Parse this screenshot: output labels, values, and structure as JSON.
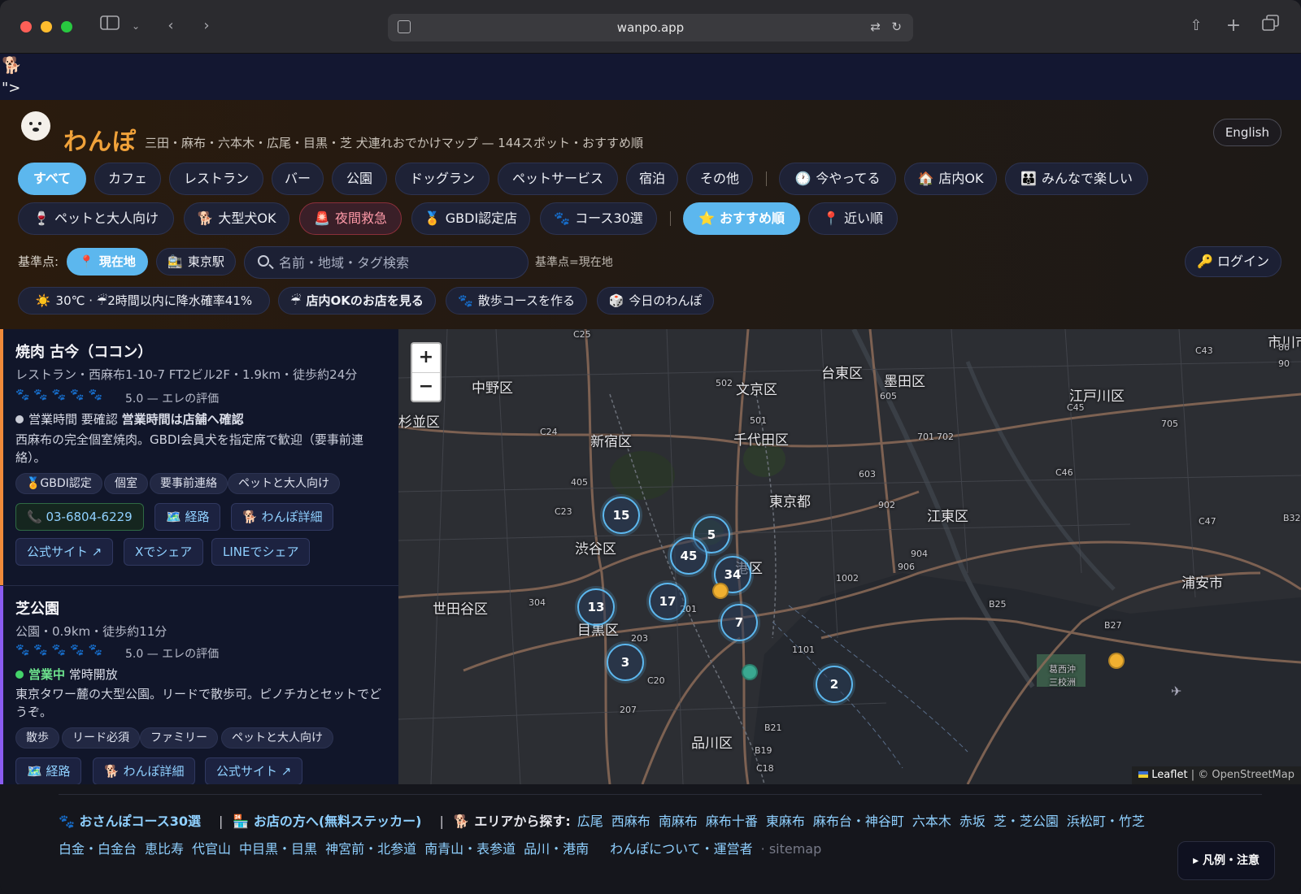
{
  "browser": {
    "url": "wanpo.app",
    "icons": [
      "sidebar-icon",
      "back-icon",
      "forward-icon",
      "translate-icon",
      "reload-icon",
      "share-icon",
      "new-tab-icon",
      "tabs-icon"
    ]
  },
  "leftover": {
    "dog": "🐕",
    "garbage": "\">"
  },
  "header": {
    "brand": "わんぽ",
    "tagline": "三田・麻布・六本木・広尾・目黒・芝 犬連れおでかけマップ — 144スポット・おすすめ順",
    "language": "English",
    "categories": [
      "すべて",
      "カフェ",
      "レストラン",
      "バー",
      "公園",
      "ドッグラン",
      "ペットサービス",
      "宿泊",
      "その他"
    ],
    "filters_row1": [
      {
        "emoji": "🕐",
        "label": "今やってる"
      },
      {
        "emoji": "🏠",
        "label": "店内OK"
      },
      {
        "emoji": "👪",
        "label": "みんなで楽しい"
      }
    ],
    "filters_row2": [
      {
        "emoji": "🍷",
        "label": "ペットと大人向け"
      },
      {
        "emoji": "🐕",
        "label": "大型犬OK"
      },
      {
        "emoji": "🚨",
        "label": "夜間救急"
      },
      {
        "emoji": "🏅",
        "label": "GBDI認定店"
      },
      {
        "emoji": "🐾",
        "label": "コース30選"
      }
    ],
    "sort": [
      {
        "emoji": "⭐",
        "label": "おすすめ順"
      },
      {
        "emoji": "📍",
        "label": "近い順"
      }
    ],
    "kijun_label": "基準点:",
    "kijun_options": [
      {
        "emoji": "📍",
        "label": "現在地"
      },
      {
        "emoji": "🚉",
        "label": "東京駅"
      }
    ],
    "search_placeholder": "名前・地域・タグ検索",
    "kijun_status": "基準点=現在地",
    "login": "🔑 ログイン",
    "info_chips": [
      {
        "emoji": "☀️",
        "label": "30℃ · ☔2時間以内に降水確率41%"
      },
      {
        "emoji": "☔",
        "label": "店内OKのお店を見る"
      },
      {
        "emoji": "🐾",
        "label": "散歩コースを作る"
      },
      {
        "emoji": "🎲",
        "label": "今日のわんぽ"
      }
    ]
  },
  "list": [
    {
      "title": "焼肉 古今（ココン）",
      "meta": "レストラン・西麻布1-10-7 FT2ビル2F・1.9km・徒歩約24分",
      "paws": "🐾🐾🐾🐾🐾",
      "rating": "5.0 — エレの評価",
      "hours_status": "営業時間 要確認",
      "hours_note": "営業時間は店舗へ確認",
      "desc": "西麻布の完全個室焼肉。GBDI会員犬を指定席で歓迎（要事前連絡）。",
      "tags": [
        "🏅GBDI認定",
        "個室",
        "要事前連絡",
        "ペットと大人向け"
      ],
      "actions": [
        "📞 03-6804-6229",
        "🗺️ 経路",
        "🐕 わんぽ詳細"
      ],
      "links": [
        "公式サイト ↗",
        "Xでシェア",
        "LINEでシェア"
      ]
    },
    {
      "title": "芝公園",
      "meta": "公園・0.9km・徒歩約11分",
      "paws": "🐾🐾🐾🐾🐾",
      "rating": "5.0 — エレの評価",
      "hours_status": "営業中",
      "hours_note": "常時開放",
      "desc": "東京タワー麓の大型公園。リードで散歩可。ピノチカとセットでどうぞ。",
      "tags": [
        "散歩",
        "リード必須",
        "ファミリー",
        "ペットと大人向け"
      ],
      "actions": [
        "🗺️ 経路",
        "🐕 わんぽ詳細",
        "公式サイト ↗"
      ]
    }
  ],
  "map": {
    "zoom_in": "+",
    "zoom_out": "−",
    "labels": [
      "中野区",
      "文京区",
      "台東区",
      "墨田区",
      "江戸川区",
      "市川市",
      "杉並区",
      "新宿区",
      "千代田区",
      "東京都",
      "江東区",
      "渋谷区",
      "港区",
      "世田谷区",
      "目黒区",
      "品川区",
      "浦安市",
      "葛西沖三校洲"
    ],
    "road_labels": [
      "C25",
      "502",
      "605",
      "501",
      "C24",
      "701",
      "702",
      "C45",
      "705",
      "C43",
      "86",
      "90",
      "405",
      "C23",
      "603",
      "902",
      "C47",
      "C46",
      "B32",
      "904",
      "906",
      "1002",
      "304",
      "203",
      "201",
      "1101",
      "B25",
      "B27",
      "207",
      "C20",
      "B21",
      "B19",
      "C18"
    ],
    "clusters": [
      "15",
      "5",
      "45",
      "34",
      "17",
      "13",
      "7",
      "3",
      "2"
    ],
    "attribution_leaflet": "Leaflet",
    "attribution_osm": "| © OpenStreetMap"
  },
  "footer": {
    "courses": "🐾 おさんぽコース30選",
    "shop": "🏪 お店の方へ(無料ステッカー)",
    "area_label": "🐕 エリアから探す:",
    "areas": [
      "広尾",
      "西麻布",
      "南麻布",
      "麻布十番",
      "東麻布",
      "麻布台・神谷町",
      "六本木",
      "赤坂",
      "芝・芝公園",
      "浜松町・竹芝",
      "白金・白金台",
      "恵比寿",
      "代官山",
      "中目黒・目黒",
      "神宮前・北参道",
      "南青山・表参道",
      "品川・港南"
    ],
    "about": "わんぽについて・運営者",
    "sitemap": "sitemap",
    "legend": "▸ 凡例・注意"
  }
}
